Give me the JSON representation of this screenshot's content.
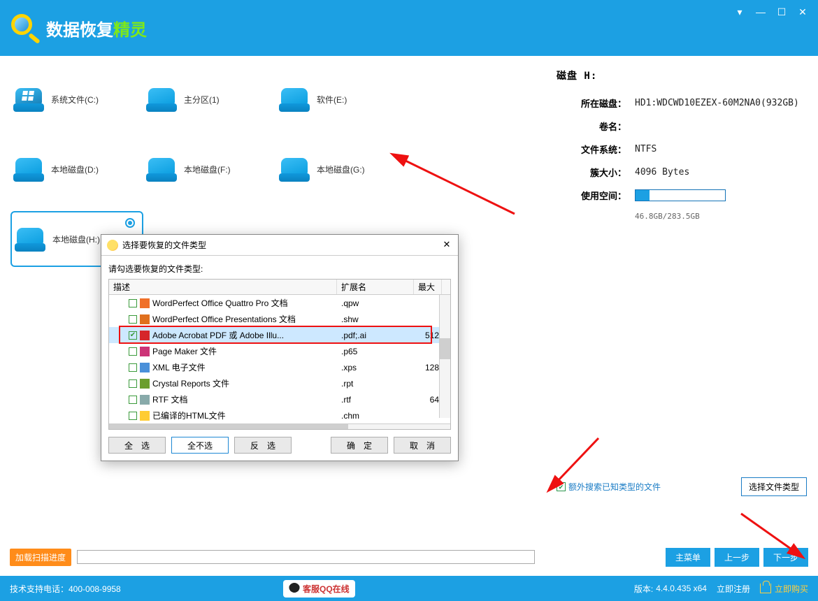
{
  "brand": {
    "part1": "数据恢复",
    "part2": "精灵"
  },
  "win": {
    "dropdown": "▾",
    "min": "—",
    "max": "☐",
    "close": "✕"
  },
  "drives": [
    {
      "label": "系统文件(C:)",
      "type": "win"
    },
    {
      "label": "主分区(1)",
      "type": "plain"
    },
    {
      "label": "软件(E:)",
      "type": "plain"
    },
    {
      "label": "本地磁盘(D:)",
      "type": "plain"
    },
    {
      "label": "本地磁盘(F:)",
      "type": "plain"
    },
    {
      "label": "本地磁盘(G:)",
      "type": "plain"
    },
    {
      "label": "本地磁盘(H:)",
      "type": "plain",
      "selected": true
    }
  ],
  "info": {
    "disk_title": "磁盘 H:",
    "rows": {
      "location_k": "所在磁盘：",
      "location_v": "HD1:WDCWD10EZEX-60M2NA0(932GB)",
      "volname_k": "卷名：",
      "volname_v": "",
      "fs_k": "文件系统：",
      "fs_v": "NTFS",
      "cluster_k": "簇大小：",
      "cluster_v": "4096 Bytes",
      "used_k": "使用空间："
    },
    "usage_text": "46.8GB/283.5GB",
    "usage_percent": 16
  },
  "extra": {
    "chk_label": "额外搜索已知类型的文件",
    "select_types": "选择文件类型"
  },
  "progress": {
    "load_btn": "加载扫描进度"
  },
  "nav": {
    "main_menu": "主菜单",
    "prev": "上一步",
    "next": "下一步"
  },
  "footer": {
    "support": "技术支持电话：400-008-9958",
    "qq": "客服QQ在线",
    "ver_label": "版本:",
    "ver": "4.4.0.435 x64",
    "register": "立即注册",
    "buy": "立即购买"
  },
  "dialog": {
    "title": "选择要恢复的文件类型",
    "prompt": "请勾选要恢复的文件类型:",
    "head": {
      "desc": "描述",
      "ext": "扩展名",
      "size": "最大"
    },
    "rows": [
      {
        "desc": "WordPerfect Office Quattro Pro 文档",
        "ext": ".qpw",
        "size": "",
        "icon": "doc",
        "checked": false
      },
      {
        "desc": "WordPerfect Office Presentations 文档",
        "ext": ".shw",
        "size": "",
        "icon": "shw",
        "checked": false
      },
      {
        "desc": "Adobe Acrobat PDF 或 Adobe Illu...",
        "ext": ".pdf;.ai",
        "size": "512",
        "icon": "pdf",
        "checked": true,
        "selected": true
      },
      {
        "desc": "Page Maker 文件",
        "ext": ".p65",
        "size": "",
        "icon": "p65",
        "checked": false
      },
      {
        "desc": "XML 电子文件",
        "ext": ".xps",
        "size": "128",
        "icon": "xps",
        "checked": false
      },
      {
        "desc": "Crystal Reports 文件",
        "ext": ".rpt",
        "size": "",
        "icon": "rpt",
        "checked": false
      },
      {
        "desc": "RTF 文档",
        "ext": ".rtf",
        "size": "64",
        "icon": "rtf",
        "checked": false
      },
      {
        "desc": "已编译的HTML文件",
        "ext": ".chm",
        "size": "",
        "icon": "chm",
        "checked": false
      }
    ],
    "btns": {
      "all": "全　选",
      "none": "全不选",
      "inv": "反　选",
      "ok": "确　定",
      "cancel": "取　消"
    }
  }
}
